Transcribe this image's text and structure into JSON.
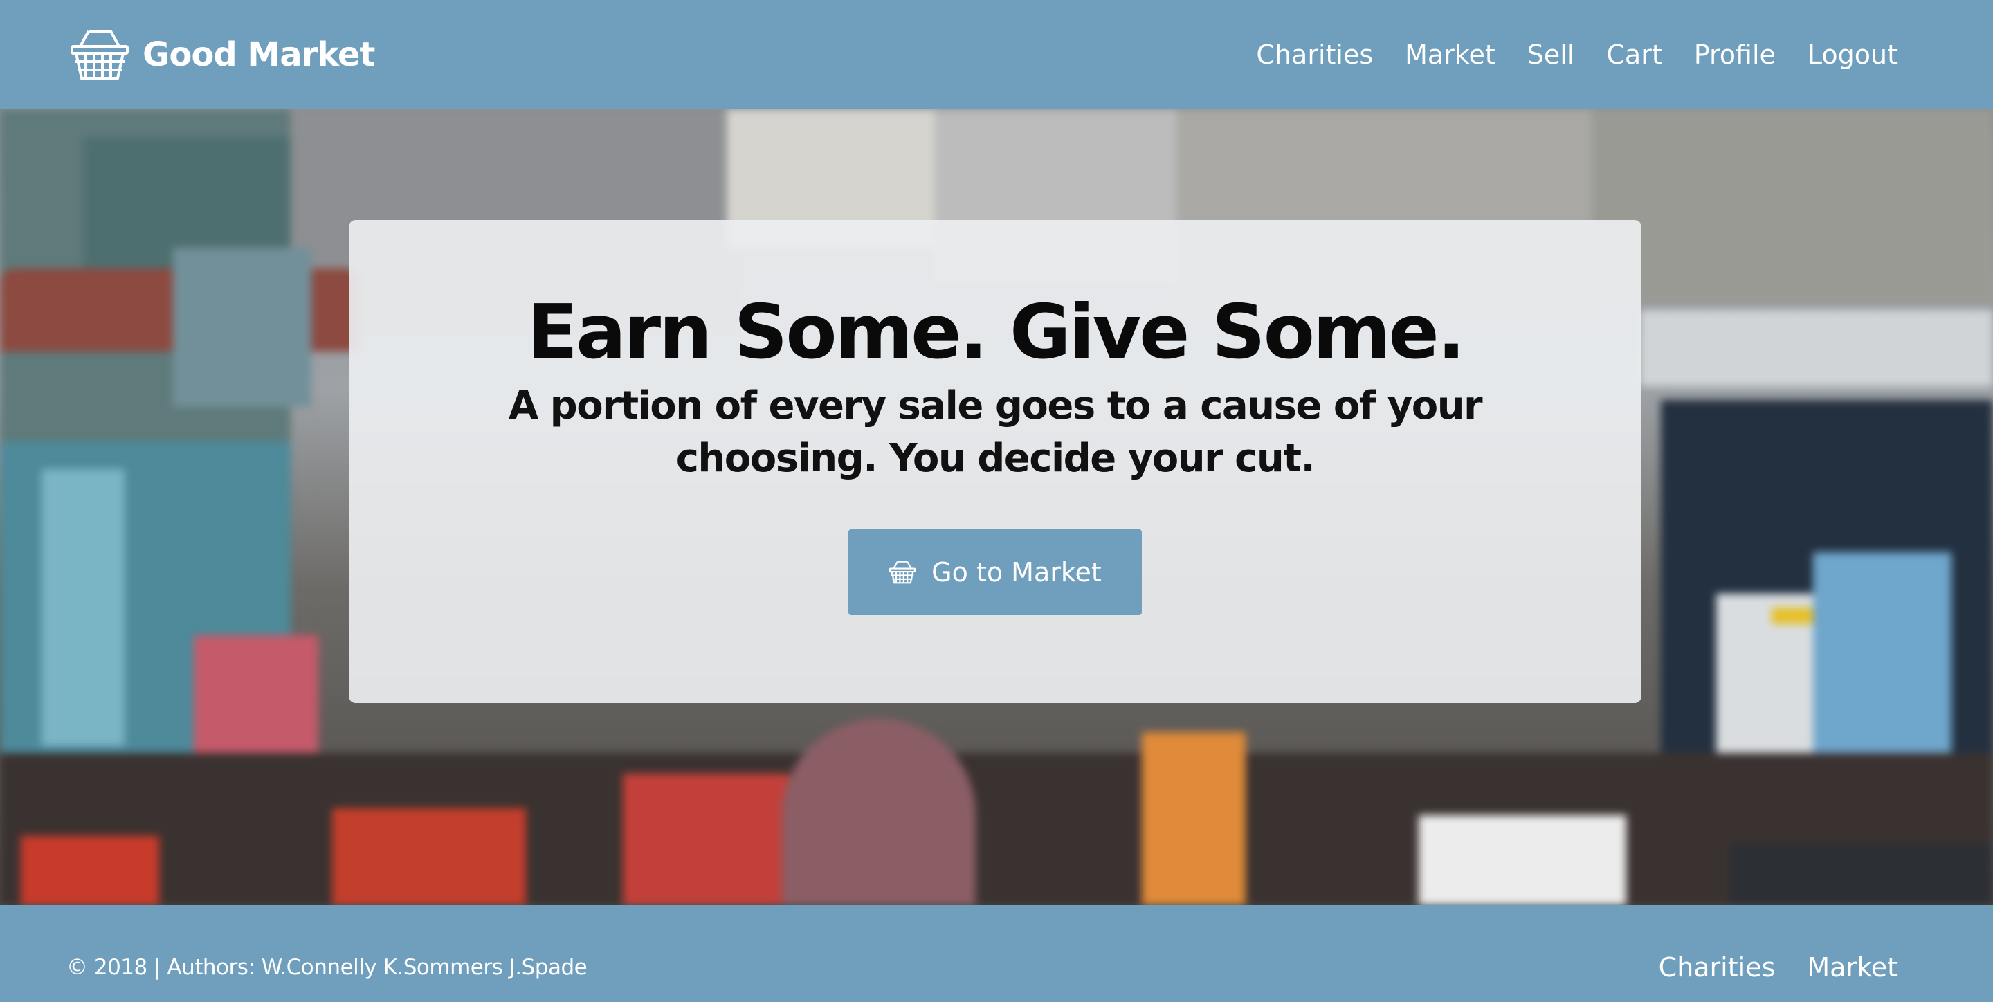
{
  "brand": {
    "name": "Good Market",
    "logo_icon": "basket-icon"
  },
  "nav": {
    "links": [
      "Charities",
      "Market",
      "Sell",
      "Cart",
      "Profile",
      "Logout"
    ]
  },
  "hero": {
    "headline": "Earn Some. Give Some.",
    "subtext": "A portion of every sale goes to a cause of your choosing. You decide your cut.",
    "cta_label": "Go to Market",
    "cta_icon": "basket-icon"
  },
  "footer": {
    "copyright": "© 2018 | Authors: W.Connelly K.Sommers J.Spade",
    "links": [
      "Charities",
      "Market"
    ]
  },
  "colors": {
    "primary": "#6f9fbd",
    "panel": "#eceef0",
    "text": "#0a0a0a"
  }
}
